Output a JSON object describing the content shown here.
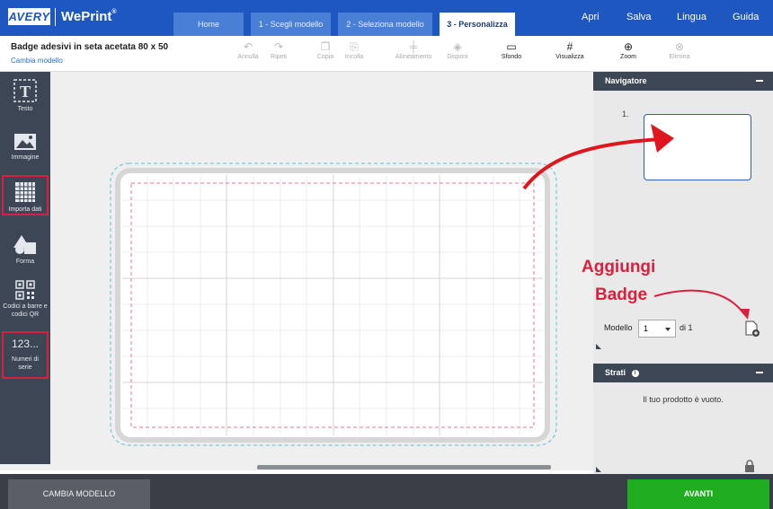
{
  "header": {
    "logo_avery": "AVERY",
    "logo_weprint": "WePrint",
    "logo_weprint_mark": "®",
    "tabs": [
      {
        "label": "Home"
      },
      {
        "label": "1 - Scegli modello"
      },
      {
        "label": "2 - Seleziona modello"
      },
      {
        "label": "3 - Personalizza"
      }
    ],
    "menu": [
      {
        "label": "Apri"
      },
      {
        "label": "Salva"
      },
      {
        "label": "Lingua"
      },
      {
        "label": "Guida"
      }
    ]
  },
  "product": {
    "title": "Badge adesivi in seta acetata 80 x 50",
    "change_link": "Cambia modello"
  },
  "toolbar": {
    "undo": "Annulla",
    "redo": "Ripeti",
    "copy": "Copia",
    "paste": "Incolla",
    "align": "Allineamento",
    "arrange": "Disponi",
    "background": "Sfondo",
    "view": "Visualizza",
    "zoom": "Zoom",
    "delete": "Elimina"
  },
  "sidebar": {
    "items": [
      {
        "label": "Testo"
      },
      {
        "label": "Immagine"
      },
      {
        "label": "Importa dati"
      },
      {
        "label": "Forma"
      },
      {
        "label": "Codici a barre e codici QR"
      },
      {
        "label": "Numeri di serie",
        "glyph": "123..."
      }
    ]
  },
  "navigator": {
    "title": "Navigatore",
    "page_number": "1.",
    "modello_label": "Modello",
    "modello_value": "1",
    "of_label": "di 1"
  },
  "layers": {
    "title": "Strati",
    "empty_text": "Il tuo prodotto è vuoto."
  },
  "annotation": {
    "line1": "Aggiungi",
    "line2": "Badge"
  },
  "footer": {
    "change_model_button": "CAMBIA MODELLO",
    "next_button": "AVANTI"
  },
  "colors": {
    "brand_blue": "#1e57c0",
    "sidebar": "#3d4654",
    "highlight_red": "#d9213f",
    "next_green": "#1fac21"
  }
}
